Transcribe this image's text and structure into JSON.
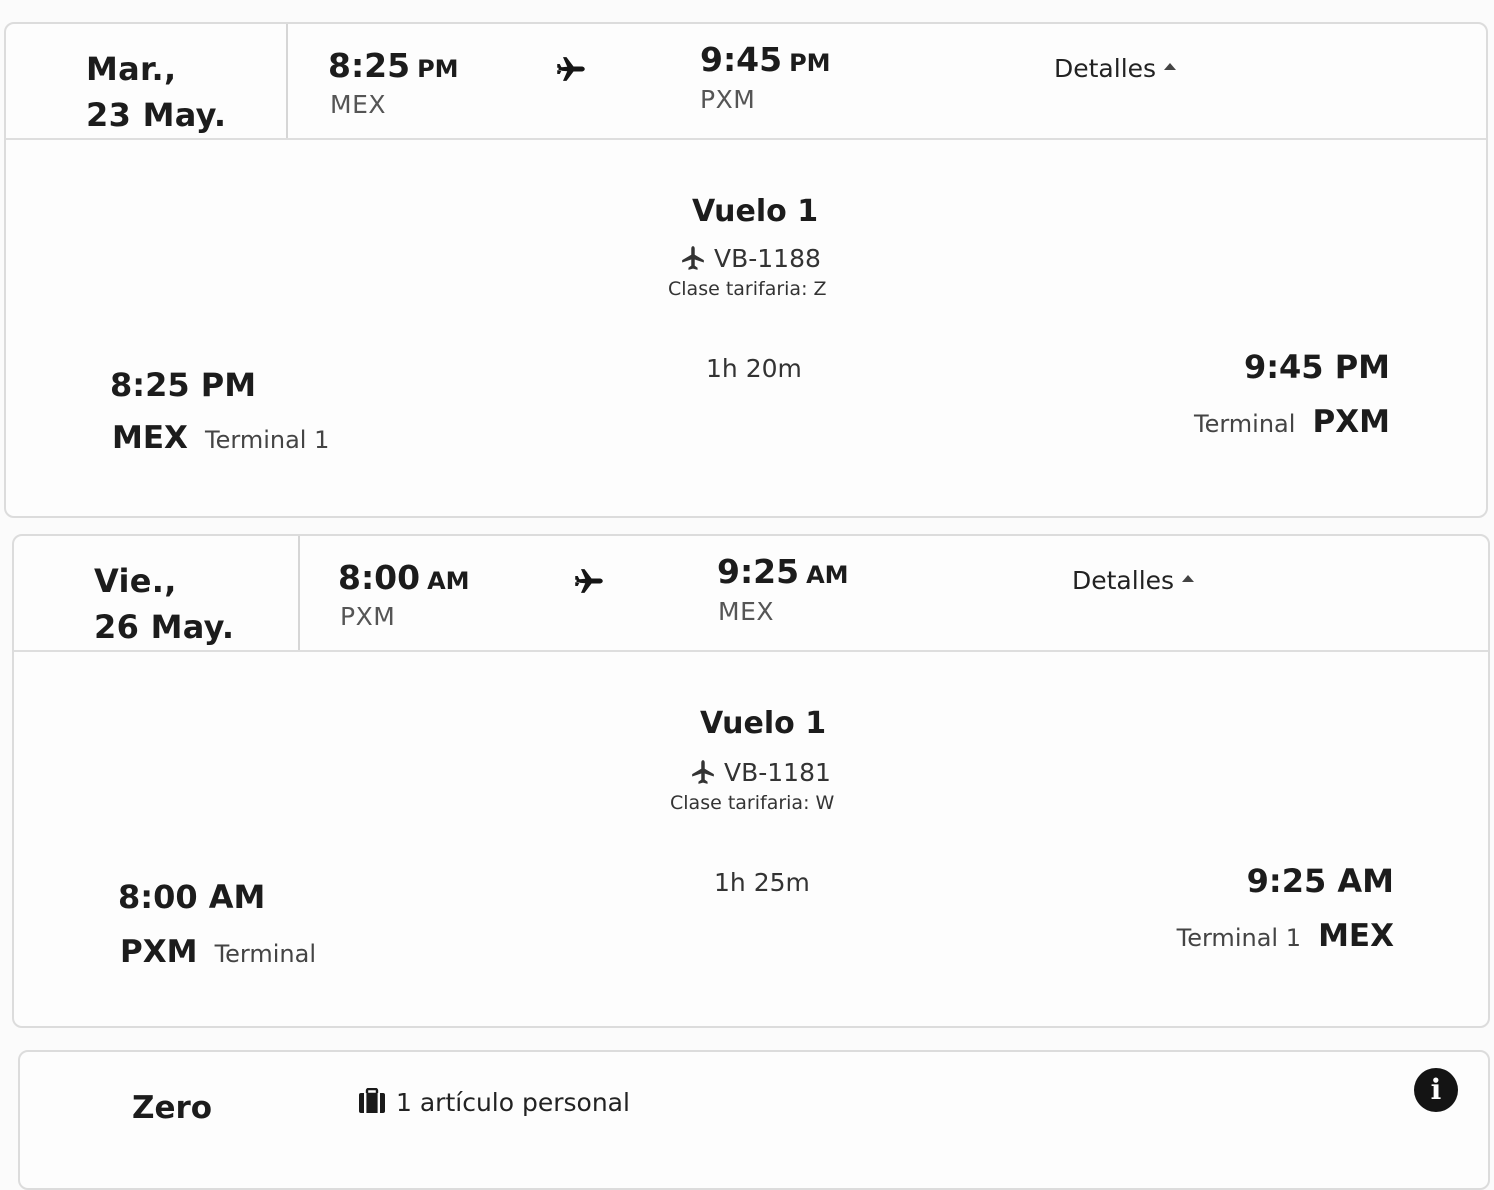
{
  "flights": [
    {
      "date_line1": "Mar.,",
      "date_line2": "23 May.",
      "dep_time": "8:25",
      "dep_ampm": "PM",
      "dep_code": "MEX",
      "arr_time": "9:45",
      "arr_ampm": "PM",
      "arr_code": "PXM",
      "details_label": "Detalles",
      "segment_title": "Vuelo 1",
      "flight_number": "VB-1188",
      "fare_class": "Clase tarifaria: Z",
      "duration": "1h 20m",
      "leg_dep_time": "8:25 PM",
      "leg_dep_code": "MEX",
      "leg_dep_terminal": "Terminal 1",
      "leg_arr_time": "9:45 PM",
      "leg_arr_terminal": "Terminal",
      "leg_arr_code": "PXM"
    },
    {
      "date_line1": "Vie.,",
      "date_line2": "26 May.",
      "dep_time": "8:00",
      "dep_ampm": "AM",
      "dep_code": "PXM",
      "arr_time": "9:25",
      "arr_ampm": "AM",
      "arr_code": "MEX",
      "details_label": "Detalles",
      "segment_title": "Vuelo 1",
      "flight_number": "VB-1181",
      "fare_class": "Clase tarifaria: W",
      "duration": "1h 25m",
      "leg_dep_time": "8:00 AM",
      "leg_dep_code": "PXM",
      "leg_dep_terminal": "Terminal",
      "leg_arr_time": "9:25 AM",
      "leg_arr_terminal": "Terminal 1",
      "leg_arr_code": "MEX"
    }
  ],
  "fare_bundle": {
    "name": "Zero",
    "item_label": "1 artículo personal",
    "item_icon": "bag-icon",
    "info_icon": "info-icon"
  }
}
